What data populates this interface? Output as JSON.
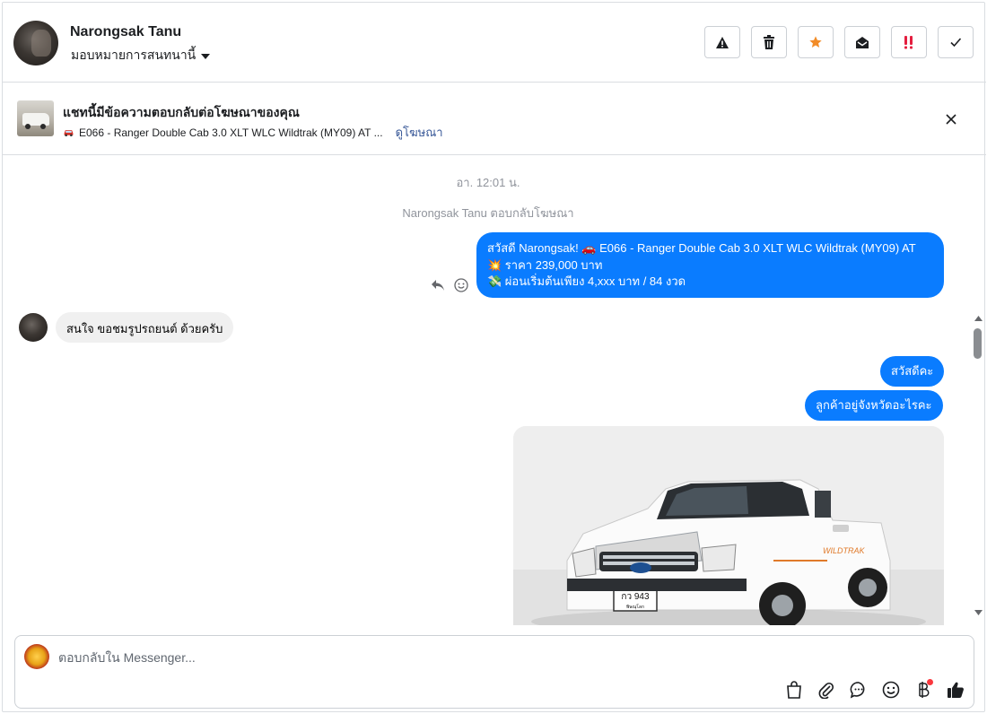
{
  "header": {
    "name": "Narongsak Tanu",
    "assign_label": "มอบหมายการสนทนานี้",
    "actions": [
      "warning-icon",
      "trash-icon",
      "star-icon",
      "mail-open-icon",
      "double-exclamation-icon",
      "check-icon"
    ],
    "star_color": "#f28c28",
    "alert_color": "#e41e3f"
  },
  "ad_banner": {
    "title": "แชทนี้มีข้อความตอบกลับต่อโฆษณาของคุณ",
    "description": "E066 - Ranger Double Cab 3.0 XLT WLC Wildtrak (MY09) AT ...",
    "link": "ดูโฆษณา"
  },
  "conversation": {
    "timestamp": "อา. 12:01 น.",
    "system_message": "Narongsak Tanu ตอบกลับโฆษณา",
    "messages": [
      {
        "from": "page",
        "lines": [
          "สวัสดี Narongsak! 🚗 E066 - Ranger Double Cab 3.0 XLT WLC Wildtrak (MY09) AT",
          "💥 ราคา 239,000 บาท",
          "💸 ผ่อนเริ่มต้นเพียง 4,xxx บาท / 84 งวด"
        ]
      },
      {
        "from": "user",
        "text": "สนใจ ขอชมรูปรถยนต์ ด้วยครับ"
      },
      {
        "from": "page",
        "text": "สวัสดีคะ"
      },
      {
        "from": "page",
        "text": "ลูกค้าอยู่จังหวัดอะไรคะ"
      }
    ],
    "photo": {
      "plate_top": "กว 943",
      "plate_bottom": "พิษณุโลก",
      "tailgate_text": "WILDTRAK"
    },
    "accent_color": "#0a7cff"
  },
  "composer": {
    "placeholder": "ตอบกลับใน Messenger...",
    "tools": [
      "bag-icon",
      "paperclip-icon",
      "chat-bubble-icon",
      "smiley-icon",
      "baht-icon",
      "thumbs-up-icon"
    ]
  }
}
